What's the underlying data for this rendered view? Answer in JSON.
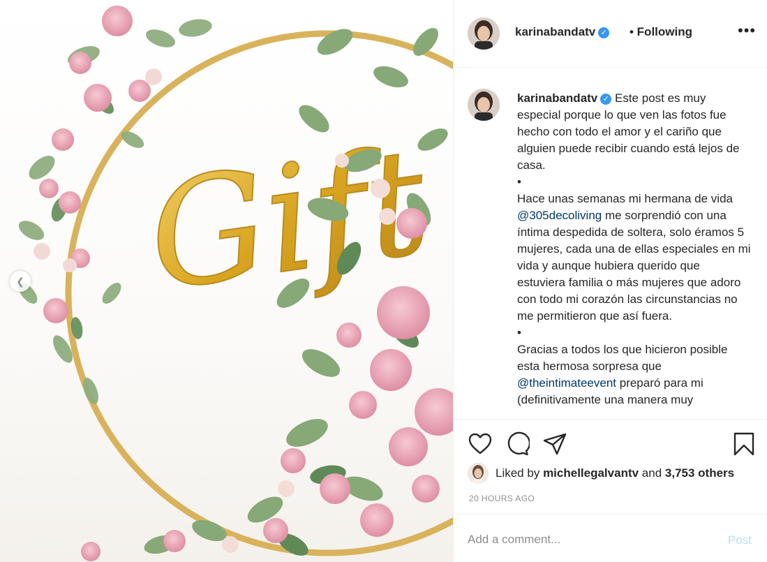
{
  "post": {
    "username": "karinabandatv",
    "verified_mark": "✓",
    "follow_status": "• Following",
    "more_icon": "more-horizontal-icon",
    "photo_text": "Gift"
  },
  "caption": {
    "username": "karinabandatv",
    "line1": "Este post es muy especial porque lo que ven las fotos fue hecho con todo el amor y el cariño que alguien puede recibir cuando está lejos de casa.",
    "bullet1": "•",
    "p2_before": "Hace unas semanas mi hermana de vida ",
    "mention1": "@305decoliving",
    "p2_after": " me sorprendió con una íntima despedida de soltera, solo éramos 5 mujeres, cada una de ellas especiales en mi vida y aunque hubiera querido que estuviera familia o más mujeres que adoro con todo mi corazón las circunstancias no me permitieron que así fuera.",
    "bullet2": "•",
    "p3_before": "Gracias a todos los que hicieron posible esta hermosa sorpresa que ",
    "mention2": "@theintimateevent",
    "p3_after": " preparó para mi (definitivamente una manera muy"
  },
  "likes": {
    "prefix": "Liked by ",
    "user": "michellegalvantv",
    "middle": " and ",
    "count": "3,753 others"
  },
  "timestamp": "20 HOURS AGO",
  "comment": {
    "placeholder": "Add a comment...",
    "post_label": "Post"
  },
  "colors": {
    "verified": "#3897f0",
    "link": "#00376b",
    "post_disabled": "#b2dffc",
    "gold": "#d9a520"
  }
}
